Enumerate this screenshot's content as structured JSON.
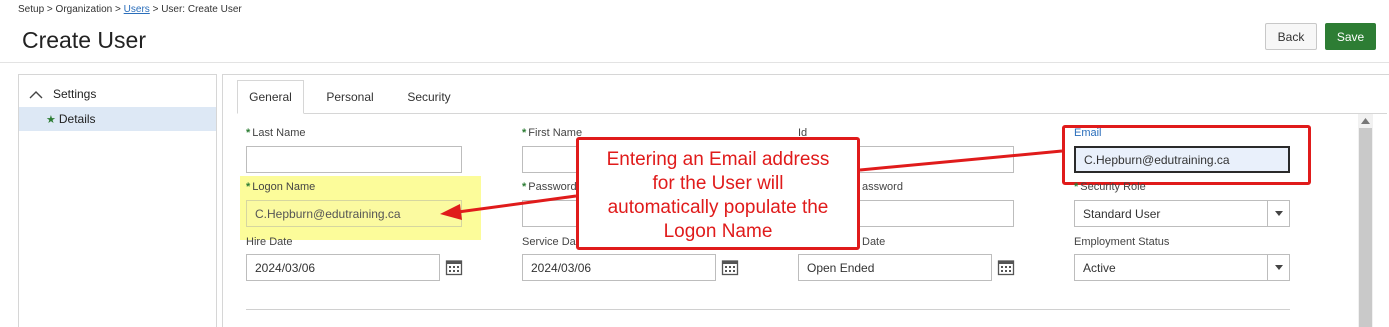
{
  "breadcrumb": {
    "setup": "Setup",
    "organization": "Organization",
    "users": "Users",
    "current": "User: Create User",
    "sep": ">"
  },
  "page_title": "Create User",
  "buttons": {
    "back": "Back",
    "save": "Save"
  },
  "sidebar": {
    "section": "Settings",
    "item": "Details",
    "item_marker": "★"
  },
  "tabs": [
    "General",
    "Personal",
    "Security"
  ],
  "fields": {
    "last_name": {
      "label": "Last Name",
      "value": ""
    },
    "first_name": {
      "label": "First Name",
      "value": ""
    },
    "id": {
      "label": "Id",
      "value": ""
    },
    "email": {
      "label": "Email",
      "value": "C.Hepburn@edutraining.ca"
    },
    "logon_name": {
      "label": "Logon Name",
      "value": "C.Hepburn@edutraining.ca"
    },
    "password": {
      "label": "Password",
      "value": ""
    },
    "confirm_password": {
      "label": "assword",
      "value": ""
    },
    "security_role": {
      "label": "Security Role",
      "value": "Standard User"
    },
    "hire_date": {
      "label": "Hire Date",
      "value": "2024/03/06"
    },
    "service_date": {
      "label": "Service Da",
      "value": "2024/03/06"
    },
    "end_date": {
      "label": "Date",
      "value": "Open Ended"
    },
    "employment_status": {
      "label": "Employment Status",
      "value": "Active"
    }
  },
  "required_marker": "*",
  "callout": {
    "lines": [
      "Entering an Email address",
      "for the User will",
      "automatically populate the",
      "Logon Name"
    ]
  },
  "colors": {
    "accent_red": "#e01b1b",
    "save_green": "#2d7d34",
    "highlight_yellow": "#fcfc9a",
    "link_blue": "#2a6ebb"
  },
  "icons": {
    "collapse": "chevron-up-icon",
    "calendar": "calendar-icon",
    "dropdown": "caret-down-icon",
    "required": "star-icon"
  }
}
